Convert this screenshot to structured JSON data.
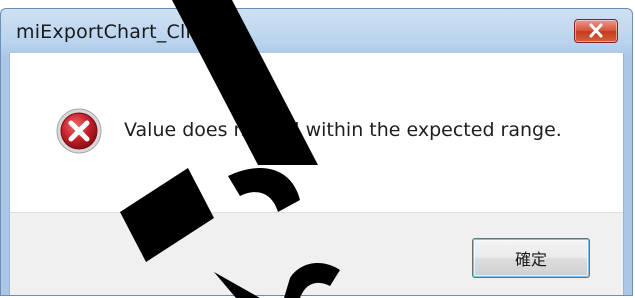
{
  "dialog": {
    "title": "miExportChart_Click",
    "message": "Value does not fall within the expected range.",
    "ok_label": "確定",
    "icon": "error-icon"
  },
  "watermark": {
    "text": "Tre"
  },
  "colors": {
    "title_bar": "#b9d3ee",
    "close_button": "#d7543a",
    "error_icon": "#c4202a",
    "button_area": "#f0f0f0"
  }
}
